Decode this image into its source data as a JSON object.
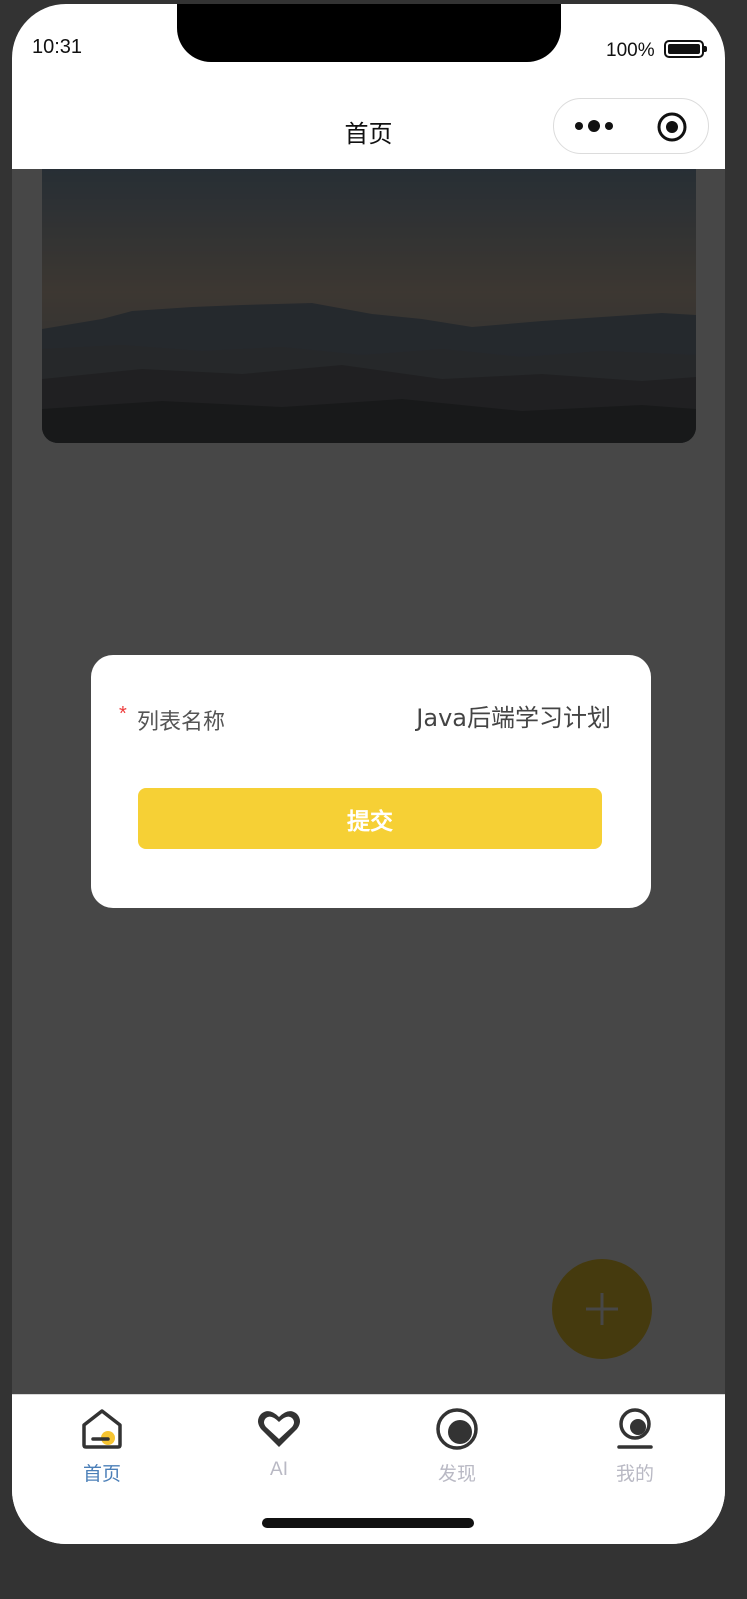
{
  "status_bar": {
    "time": "10:31",
    "battery": "100%"
  },
  "navbar": {
    "title": "首页",
    "more_icon": "more-dots-icon",
    "close_icon": "target-circle-icon"
  },
  "dialog": {
    "field_label": "列表名称",
    "required_mark": "*",
    "field_value": "Java后端学习计划",
    "submit_label": "提交"
  },
  "fab": {
    "icon": "plus-icon"
  },
  "tabbar": {
    "items": [
      {
        "label": "首页",
        "icon": "home-icon",
        "active": true
      },
      {
        "label": "AI",
        "icon": "heart-icon",
        "active": false
      },
      {
        "label": "发现",
        "icon": "discover-icon",
        "active": false
      },
      {
        "label": "我的",
        "icon": "profile-icon",
        "active": false
      }
    ]
  },
  "colors": {
    "accent": "#f6d035",
    "active_tab": "#4b7fb8",
    "inactive_tab": "#b9b9c4",
    "required": "#ee3b3b"
  }
}
